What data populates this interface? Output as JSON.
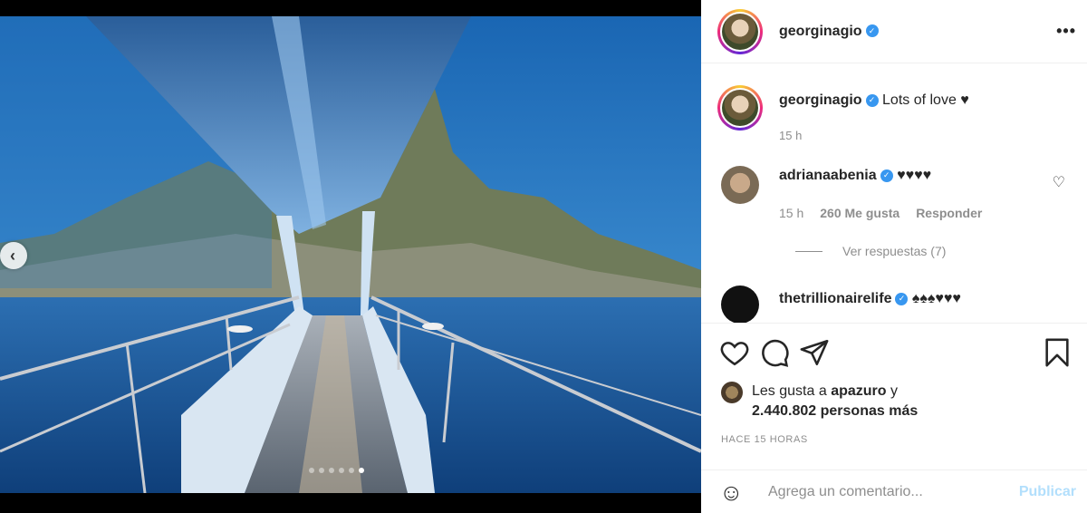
{
  "post": {
    "username": "georginagio",
    "caption": "Lots of love ♥",
    "caption_time": "15 h",
    "carousel": {
      "slides": 6,
      "active_index": 5
    }
  },
  "icons": {
    "more": "more-options-icon",
    "verified": "verified-badge-icon",
    "prev": "chevron-left-icon",
    "heart": "heart-icon",
    "comment": "comment-icon",
    "share": "send-icon",
    "bookmark": "bookmark-icon",
    "emoji": "emoji-icon"
  },
  "comments": [
    {
      "username": "adrianaabenia",
      "text": "♥♥♥♥",
      "time": "15 h",
      "likes": "260 Me gusta",
      "reply": "Responder",
      "view_replies": "Ver respuestas (7)"
    },
    {
      "username": "thetrillionairelife",
      "text": "♠♠♠♥♥♥"
    }
  ],
  "likes": {
    "line1_prefix": "Les gusta a",
    "line1_user": "apazuro",
    "line1_suffix": "y",
    "line2": "2.440.802 personas más"
  },
  "date": "HACE 15 HORAS",
  "add_comment": {
    "placeholder": "Agrega un comentario...",
    "publish": "Publicar"
  },
  "colors": {
    "verified": "#3897f0",
    "publish_disabled": "#b2dffc",
    "muted": "#8e8e8e"
  }
}
